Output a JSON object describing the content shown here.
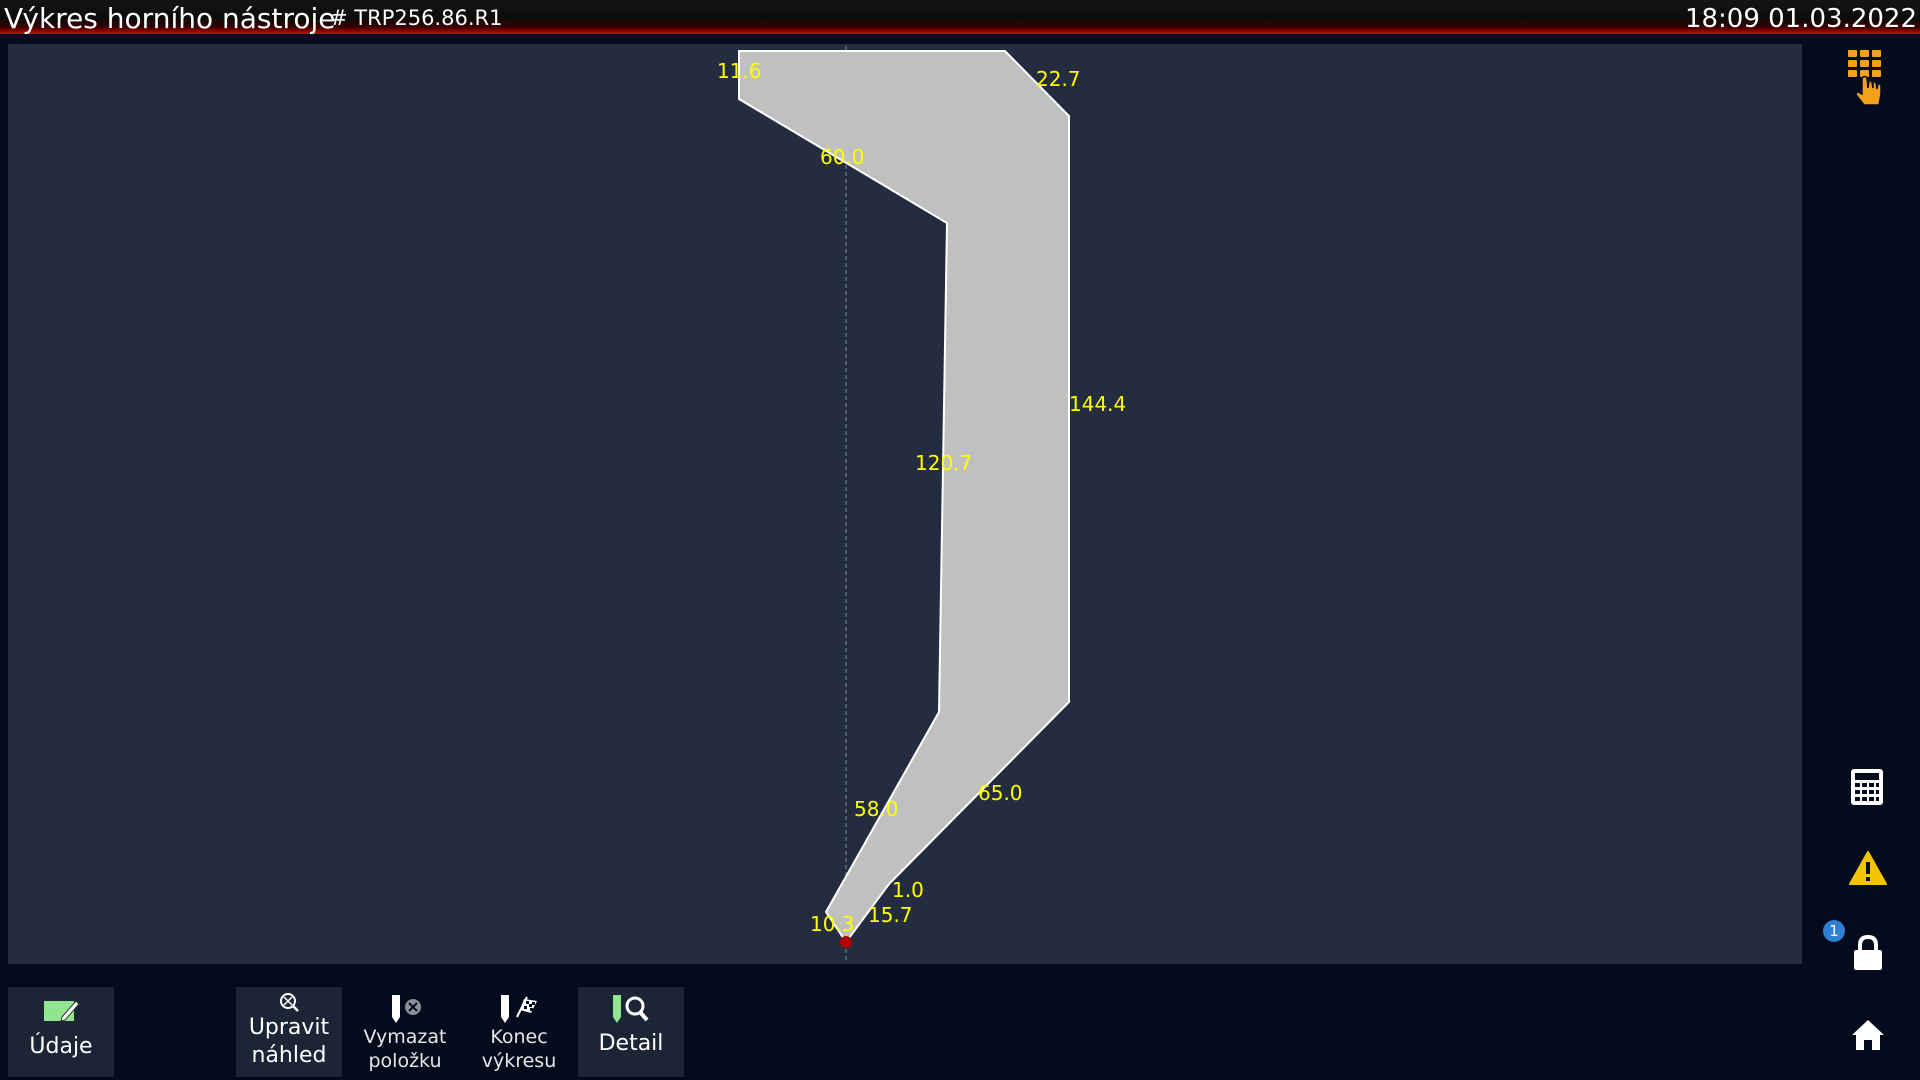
{
  "header": {
    "title": "Výkres horního nástroje",
    "program": "# TRP256.86.R1",
    "datetime": "18:09 01.03.2022"
  },
  "drawing": {
    "dimensions": {
      "top_left": "11.6",
      "top_right": "22.7",
      "upper_slope": "60.0",
      "right_edge": "144.4",
      "inner_edge": "120.7",
      "lower_left": "58.0",
      "lower_right": "65.0",
      "tip_small": "1.0",
      "tip_right": "15.7",
      "tip_left": "10.3"
    }
  },
  "sidebar": {
    "notification_count": "1"
  },
  "toolbar": {
    "udaje": "Údaje",
    "upravit_line1": "Upravit",
    "upravit_line2": "náhled",
    "vymazat_line1": "Vymazat",
    "vymazat_line2": "položku",
    "konec_line1": "Konec",
    "konec_line2": "výkresu",
    "detail": "Detail"
  },
  "colors": {
    "canvas": "#232d3f",
    "background": "#030b1c",
    "tool_fill": "#c0c0c0",
    "dimension_text": "#ffff00",
    "accent_orange": "#f5a01a",
    "title_bar_red": "#d00000"
  }
}
